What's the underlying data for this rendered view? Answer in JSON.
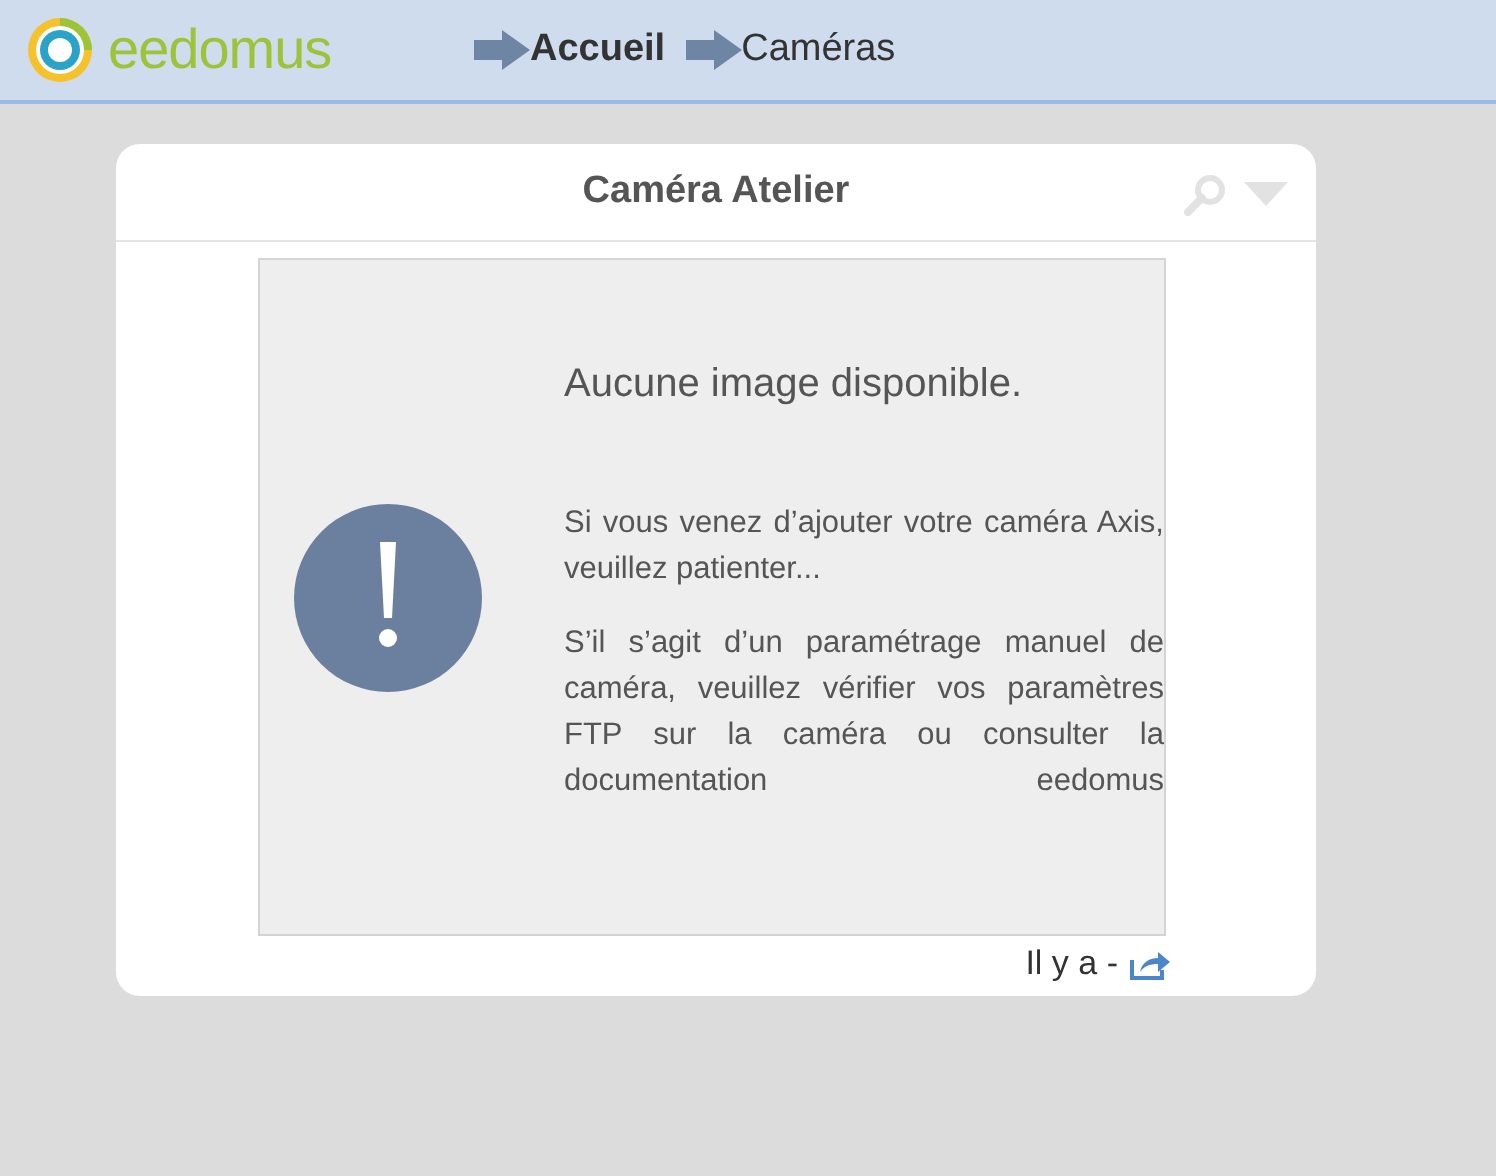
{
  "header": {
    "logo_text": "eedomus",
    "breadcrumb": [
      {
        "label": "Accueil",
        "emphasized": true
      },
      {
        "label": "Caméras",
        "emphasized": false
      }
    ]
  },
  "camera_card": {
    "title": "Caméra Atelier",
    "placeholder": {
      "heading": "Aucune image disponible.",
      "paragraphs": [
        "Si vous venez d’ajouter votre caméra Axis, veuillez patienter...",
        "S’il s’agit d’un paramétrage manuel de caméra, veuillez vérifier vos paramètres FTP sur la caméra ou consulter la documentation eedomus"
      ]
    },
    "timestamp": "Il y a -"
  }
}
